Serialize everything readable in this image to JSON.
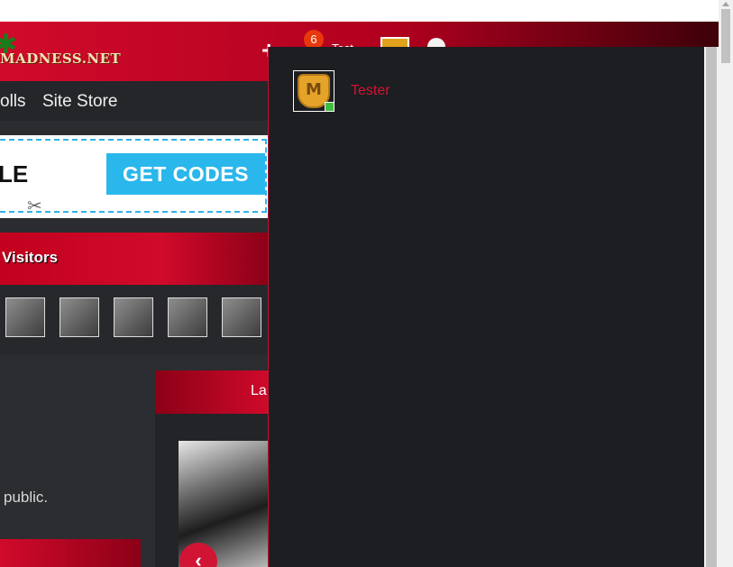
{
  "header": {
    "logo_text": "MADNESS.NET",
    "notification_count": "6",
    "username_short": "Test",
    "colors": {
      "header_red": "#d10a2b",
      "badge": "#e8380c"
    }
  },
  "nav": {
    "items": [
      {
        "label": "olls"
      },
      {
        "label": "Site Store"
      }
    ]
  },
  "promo": {
    "partial_text": "LE",
    "button_label": "GET CODES"
  },
  "visitors": {
    "label": "Visitors",
    "count_shown": 5
  },
  "latest": {
    "label": "La"
  },
  "content": {
    "public_text": "public.",
    "right_edge_text": "M"
  },
  "dropdown": {
    "username": "Tester",
    "avatar_letter": "M",
    "online": true,
    "colors": {
      "username": "#d51335"
    }
  },
  "icons": [
    "plus-icon",
    "bell-icon",
    "coins-icon",
    "scissors-icon",
    "chevron-left-icon",
    "cannabis-leaf-icon"
  ]
}
